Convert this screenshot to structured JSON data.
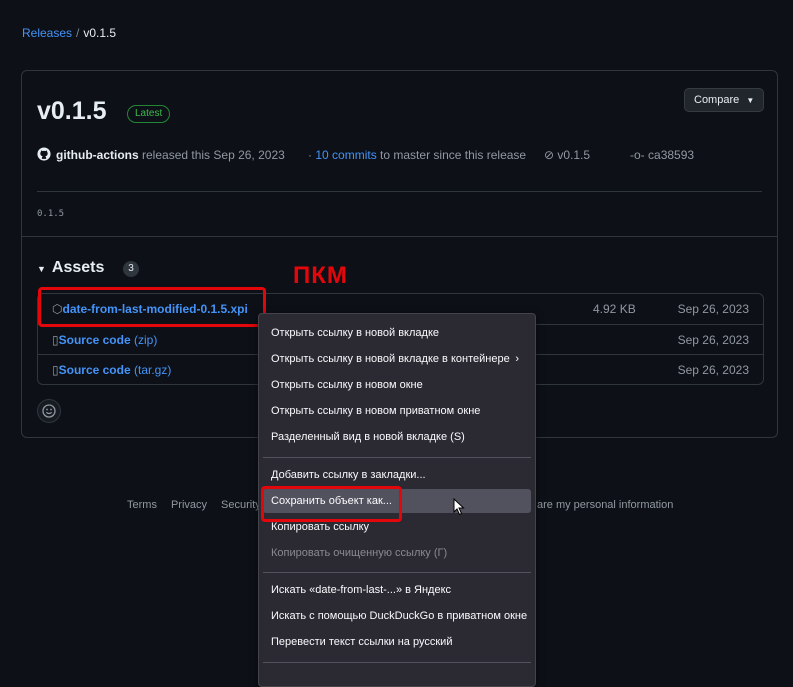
{
  "breadcrumb": {
    "parent": "Releases",
    "separator": "/",
    "current": "v0.1.5"
  },
  "release": {
    "title": "v0.1.5",
    "badge": "Latest",
    "compare_label": "Compare",
    "author": "github-actions",
    "released_text": "released this Sep 26, 2023",
    "commits_prefix": "·",
    "commits_link": "10 commits",
    "commits_suffix": "to master since this release",
    "tag": "v0.1.5",
    "commit": "ca38593",
    "body": "0.1.5"
  },
  "assets": {
    "title": "Assets",
    "count": "3",
    "rows": [
      {
        "name": "date-from-last-modified-0.1.5.xpi",
        "ext": "",
        "size": "4.92 KB",
        "date": "Sep 26, 2023",
        "icon": "package-icon"
      },
      {
        "name": "Source code",
        "ext": "(zip)",
        "size": "",
        "date": "Sep 26, 2023",
        "icon": "file-zip-icon"
      },
      {
        "name": "Source code",
        "ext": "(tar.gz)",
        "size": "",
        "date": "Sep 26, 2023",
        "icon": "file-zip-icon"
      }
    ]
  },
  "annotation": {
    "label": "ПКМ",
    "color": "#e3060a"
  },
  "footer": {
    "left": [
      "Terms",
      "Privacy",
      "Security"
    ],
    "right": "are my personal information"
  },
  "context_menu": {
    "items": [
      {
        "label": "Открыть ссылку в новой вкладке",
        "disabled": false
      },
      {
        "label": "Открыть ссылку в новой вкладке в контейнере",
        "disabled": false,
        "submenu": true
      },
      {
        "label": "Открыть ссылку в новом окне",
        "disabled": false
      },
      {
        "label": "Открыть ссылку в новом приватном окне",
        "disabled": false
      },
      {
        "label": "Разделенный вид в новой вкладке (S)",
        "disabled": false
      },
      {
        "label": "Добавить ссылку в закладки...",
        "disabled": false
      },
      {
        "label": "Сохранить объект как...",
        "disabled": false,
        "hovered": true
      },
      {
        "label": "Копировать ссылку",
        "disabled": false
      },
      {
        "label": "Копировать очищенную ссылку (Г)",
        "disabled": true
      },
      {
        "label": "Искать «date-from-last-...» в Яндекс",
        "disabled": false
      },
      {
        "label": "Искать с помощью DuckDuckGo в приватном окне",
        "disabled": false
      },
      {
        "label": "Перевести текст ссылки на русский",
        "disabled": false
      }
    ]
  },
  "colors": {
    "background": "#0d1117",
    "link": "#4493f8",
    "menu_bg": "#2b2a33",
    "highlight": "#e3060a"
  }
}
